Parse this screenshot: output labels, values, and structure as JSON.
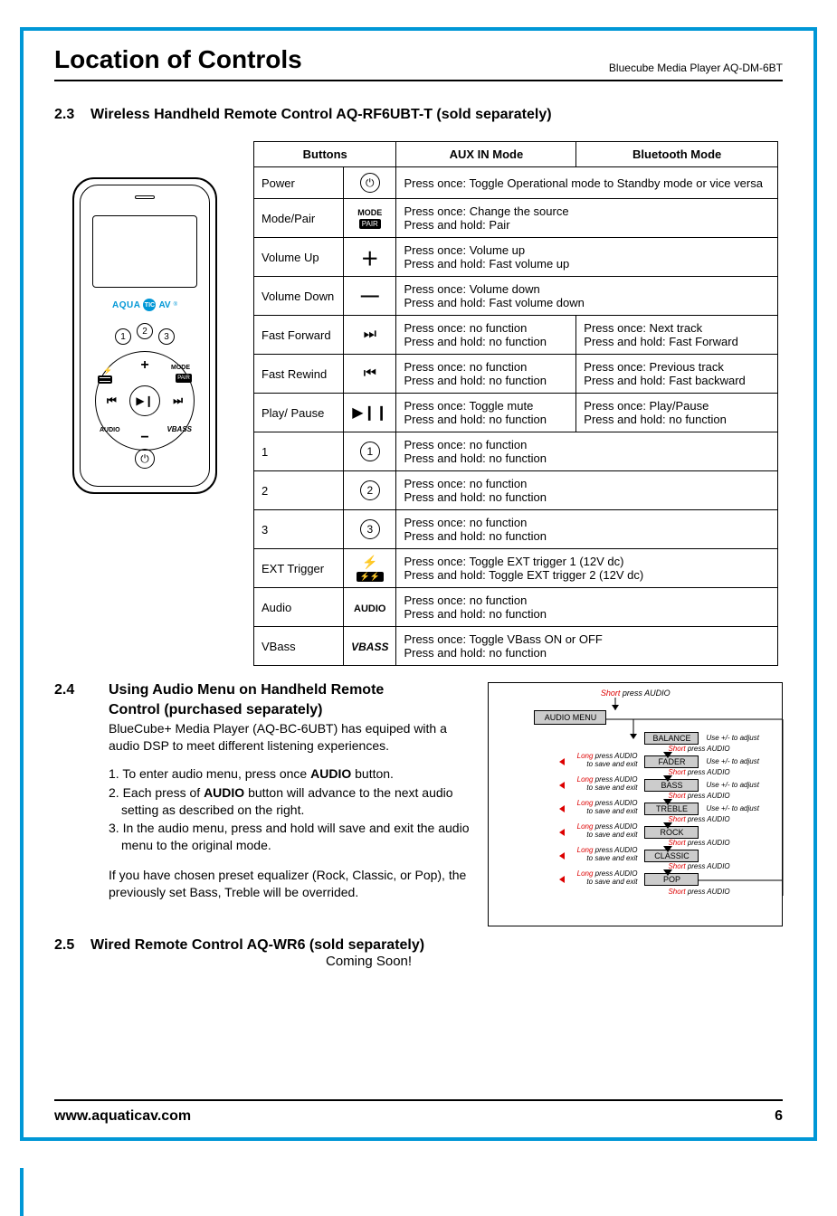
{
  "header": {
    "title": "Location of Controls",
    "model": "Bluecube Media Player AQ-DM-6BT"
  },
  "section23": {
    "num": "2.3",
    "title": "Wireless Handheld Remote Control AQ-RF6UBT-T (sold separately)"
  },
  "remote": {
    "logo_left": "AQUA",
    "logo_disc": "TIC",
    "logo_right": "AV",
    "logo_r": "®",
    "preset1": "1",
    "preset2": "2",
    "preset3": "3",
    "plus": "+",
    "minus": "−",
    "prev": "⏮",
    "next": "⏭",
    "play": "▶❙",
    "mode": "MODE",
    "pair": "PAIR",
    "audio": "AUDIO",
    "vbass": "VBASS",
    "power": "⏻"
  },
  "table": {
    "h1": "Buttons",
    "h2": "AUX IN Mode",
    "h3": "Bluetooth Mode",
    "rows": [
      {
        "name": "Power",
        "aux": "Press once: Toggle Operational mode to Standby mode or vice versa",
        "bt": "",
        "span": true
      },
      {
        "name": "Mode/Pair",
        "aux": "Press once: Change the source\nPress and hold: Pair",
        "bt": "",
        "span": true
      },
      {
        "name": "Volume Up",
        "aux": "Press once: Volume up\nPress and hold: Fast volume up",
        "bt": "",
        "span": true
      },
      {
        "name": "Volume Down",
        "aux": "Press once: Volume down\nPress and hold: Fast volume down",
        "bt": "",
        "span": true
      },
      {
        "name": "Fast Forward",
        "aux": "Press once: no function\nPress and hold: no function",
        "bt": "Press once: Next track\nPress and hold: Fast Forward"
      },
      {
        "name": "Fast Rewind",
        "aux": "Press once: no function\nPress and hold: no function",
        "bt": "Press once: Previous track\nPress and hold: Fast backward"
      },
      {
        "name": "Play/ Pause",
        "aux": "Press once: Toggle mute\nPress and hold: no function",
        "bt": "Press once: Play/Pause\nPress and hold: no function"
      },
      {
        "name": "1",
        "aux": "Press once: no function\nPress and hold: no function",
        "bt": "",
        "span": true
      },
      {
        "name": "2",
        "aux": "Press once: no function\nPress and hold: no function",
        "bt": "",
        "span": true
      },
      {
        "name": "3",
        "aux": "Press once: no function\nPress and hold: no function",
        "bt": "",
        "span": true
      },
      {
        "name": "EXT Trigger",
        "aux": "Press once: Toggle EXT trigger 1 (12V dc)\nPress and hold: Toggle EXT trigger 2 (12V dc)",
        "bt": "",
        "span": true
      },
      {
        "name": "Audio",
        "aux": "Press once: no function\nPress and hold: no function",
        "bt": "",
        "span": true
      },
      {
        "name": "VBass",
        "aux": "Press once: Toggle VBass ON or OFF\nPress and hold: no function",
        "bt": "",
        "span": true
      }
    ],
    "icons": {
      "power": "⏻",
      "plus": "＋",
      "minus": "—",
      "ff": "⏭❙",
      "fr": "❙⏮",
      "pp": "▶❙❙",
      "n1": "1",
      "n2": "2",
      "n3": "3",
      "bolt": "⚡",
      "bolts": "⚡⚡",
      "audio": "AUDIO",
      "vbass": "VBASS",
      "mode": "MODE",
      "pair": "PAIR"
    }
  },
  "section24": {
    "num": "2.4",
    "title1": "Using Audio Menu on Handheld Remote",
    "title2": "Control (purchased separately)",
    "p1": "BlueCube+ Media Player (AQ-BC-6UBT) has equiped with a audio DSP to meet different listening experiences.",
    "li1": "1. To enter audio menu, press once AUDIO button.",
    "li2": "2. Each press of AUDIO button will advance to the next audio setting as described on the right.",
    "li3": "3. In the audio menu, press and hold will save and exit the audio menu to the original mode.",
    "p2": "If you have chosen preset equalizer (Rock, Classic, or Pop), the previously set Bass, Treble will be overrided.",
    "li1_bold": "AUDIO",
    "li2_bold": "AUDIO"
  },
  "flow": {
    "start_short": "Short",
    "start_rest": " press AUDIO",
    "menu": "AUDIO MENU",
    "balance": "BALANCE",
    "fader": "FADER",
    "bass": "BASS",
    "treble": "TREBLE",
    "rock": "ROCK",
    "classic": "CLASSIC",
    "pop": "POP",
    "adj": "Use +/-  to adjust",
    "adj2": "Use +/- to adjust",
    "sp_s": "Short",
    "sp_rest": " press AUDIO",
    "lp_l": "Long",
    "lp_rest": " press AUDIO",
    "lp_sub": "to save and exit"
  },
  "section25": {
    "num": "2.5",
    "title": "Wired Remote Control AQ-WR6 (sold separately)",
    "soon": "Coming Soon!"
  },
  "footer": {
    "url": "www.aquaticav.com",
    "page": "6"
  }
}
